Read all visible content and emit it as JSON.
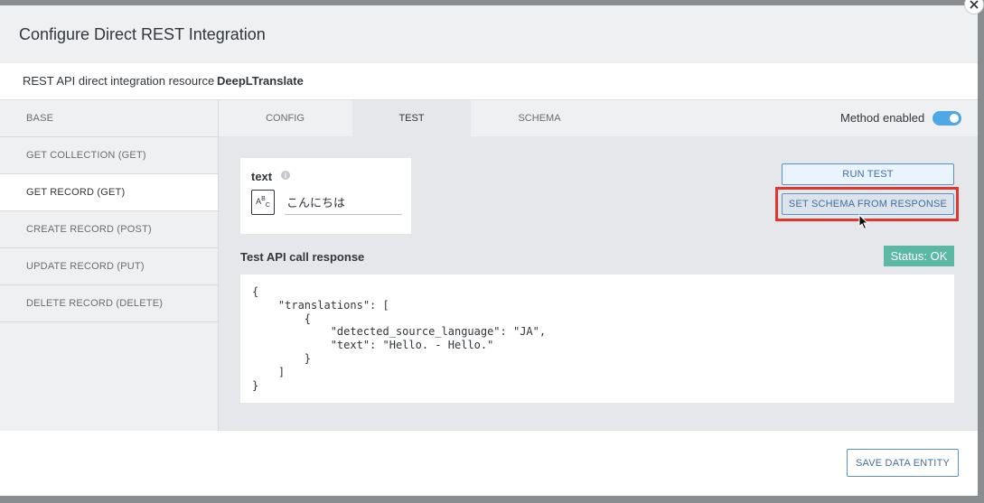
{
  "dialog": {
    "title": "Configure Direct REST Integration",
    "close_icon": "close-icon"
  },
  "resource": {
    "label": "REST API direct integration resource",
    "value": "DeepLTranslate"
  },
  "sidebar": {
    "items": [
      {
        "label": "BASE",
        "active": false
      },
      {
        "label": "GET COLLECTION (GET)",
        "active": false
      },
      {
        "label": "GET RECORD (GET)",
        "active": true
      },
      {
        "label": "CREATE RECORD (POST)",
        "active": false
      },
      {
        "label": "UPDATE RECORD (PUT)",
        "active": false
      },
      {
        "label": "DELETE RECORD (DELETE)",
        "active": false
      }
    ]
  },
  "tabs": {
    "items": [
      {
        "label": "CONFIG",
        "active": false
      },
      {
        "label": "TEST",
        "active": true
      },
      {
        "label": "SCHEMA",
        "active": false
      }
    ],
    "method_enabled_label": "Method enabled",
    "method_enabled": true
  },
  "test": {
    "param_name": "text",
    "param_type_icon": "ABC",
    "param_value": "こんにちは",
    "run_label": "RUN TEST",
    "schema_label": "SET SCHEMA FROM RESPONSE",
    "response_label": "Test API call response",
    "status": "Status: OK",
    "status_color": "#5bb8a3",
    "response_body": "{\n    \"translations\": [\n        {\n            \"detected_source_language\": \"JA\",\n            \"text\": \"Hello. - Hello.\"\n        }\n    ]\n}"
  },
  "footer": {
    "save_label": "SAVE DATA ENTITY"
  },
  "colors": {
    "accent": "#4ea7e6",
    "highlight": "#e0362c"
  }
}
